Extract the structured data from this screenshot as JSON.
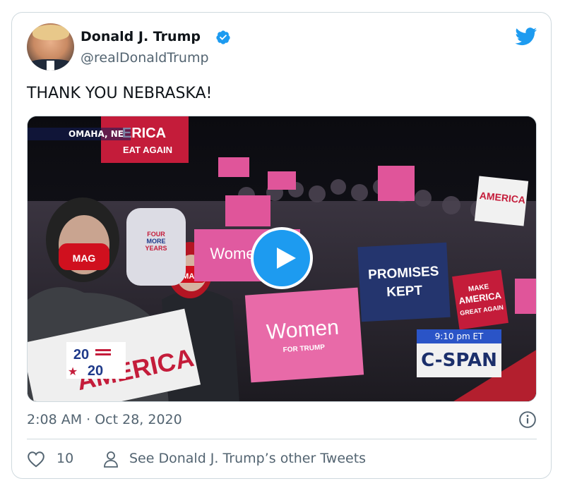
{
  "author": {
    "name": "Donald J. Trump",
    "handle": "@realDonaldTrump",
    "verified": true
  },
  "tweet": {
    "text": "THANK YOU NEBRASKA!",
    "timestamp": "2:08 AM · Oct 28, 2020"
  },
  "video": {
    "location": "OMAHA, NE",
    "time_badge": "9:10 pm ET",
    "network": "C-SPAN",
    "signs": {
      "main": "Women",
      "main_sub": "FOR TRUMP",
      "promises_line1": "PROMISES",
      "promises_line2": "KEPT",
      "maga_line1": "MAKE",
      "maga_line2": "AMERICA",
      "maga_line3": "GREAT AGAIN",
      "big_sign": "AMERICA",
      "logo_top": "20",
      "logo_bottom": "20"
    }
  },
  "actions": {
    "likes": "10",
    "other_tweets_label": "See Donald J. Trump’s other Tweets"
  },
  "colors": {
    "twitter_blue": "#1d9bf0",
    "text_primary": "#0f1419",
    "text_secondary": "#536471",
    "border": "#cfd9de"
  },
  "icons": [
    "verified-badge-icon",
    "twitter-bird-icon",
    "play-icon",
    "info-icon",
    "heart-icon",
    "person-icon"
  ]
}
